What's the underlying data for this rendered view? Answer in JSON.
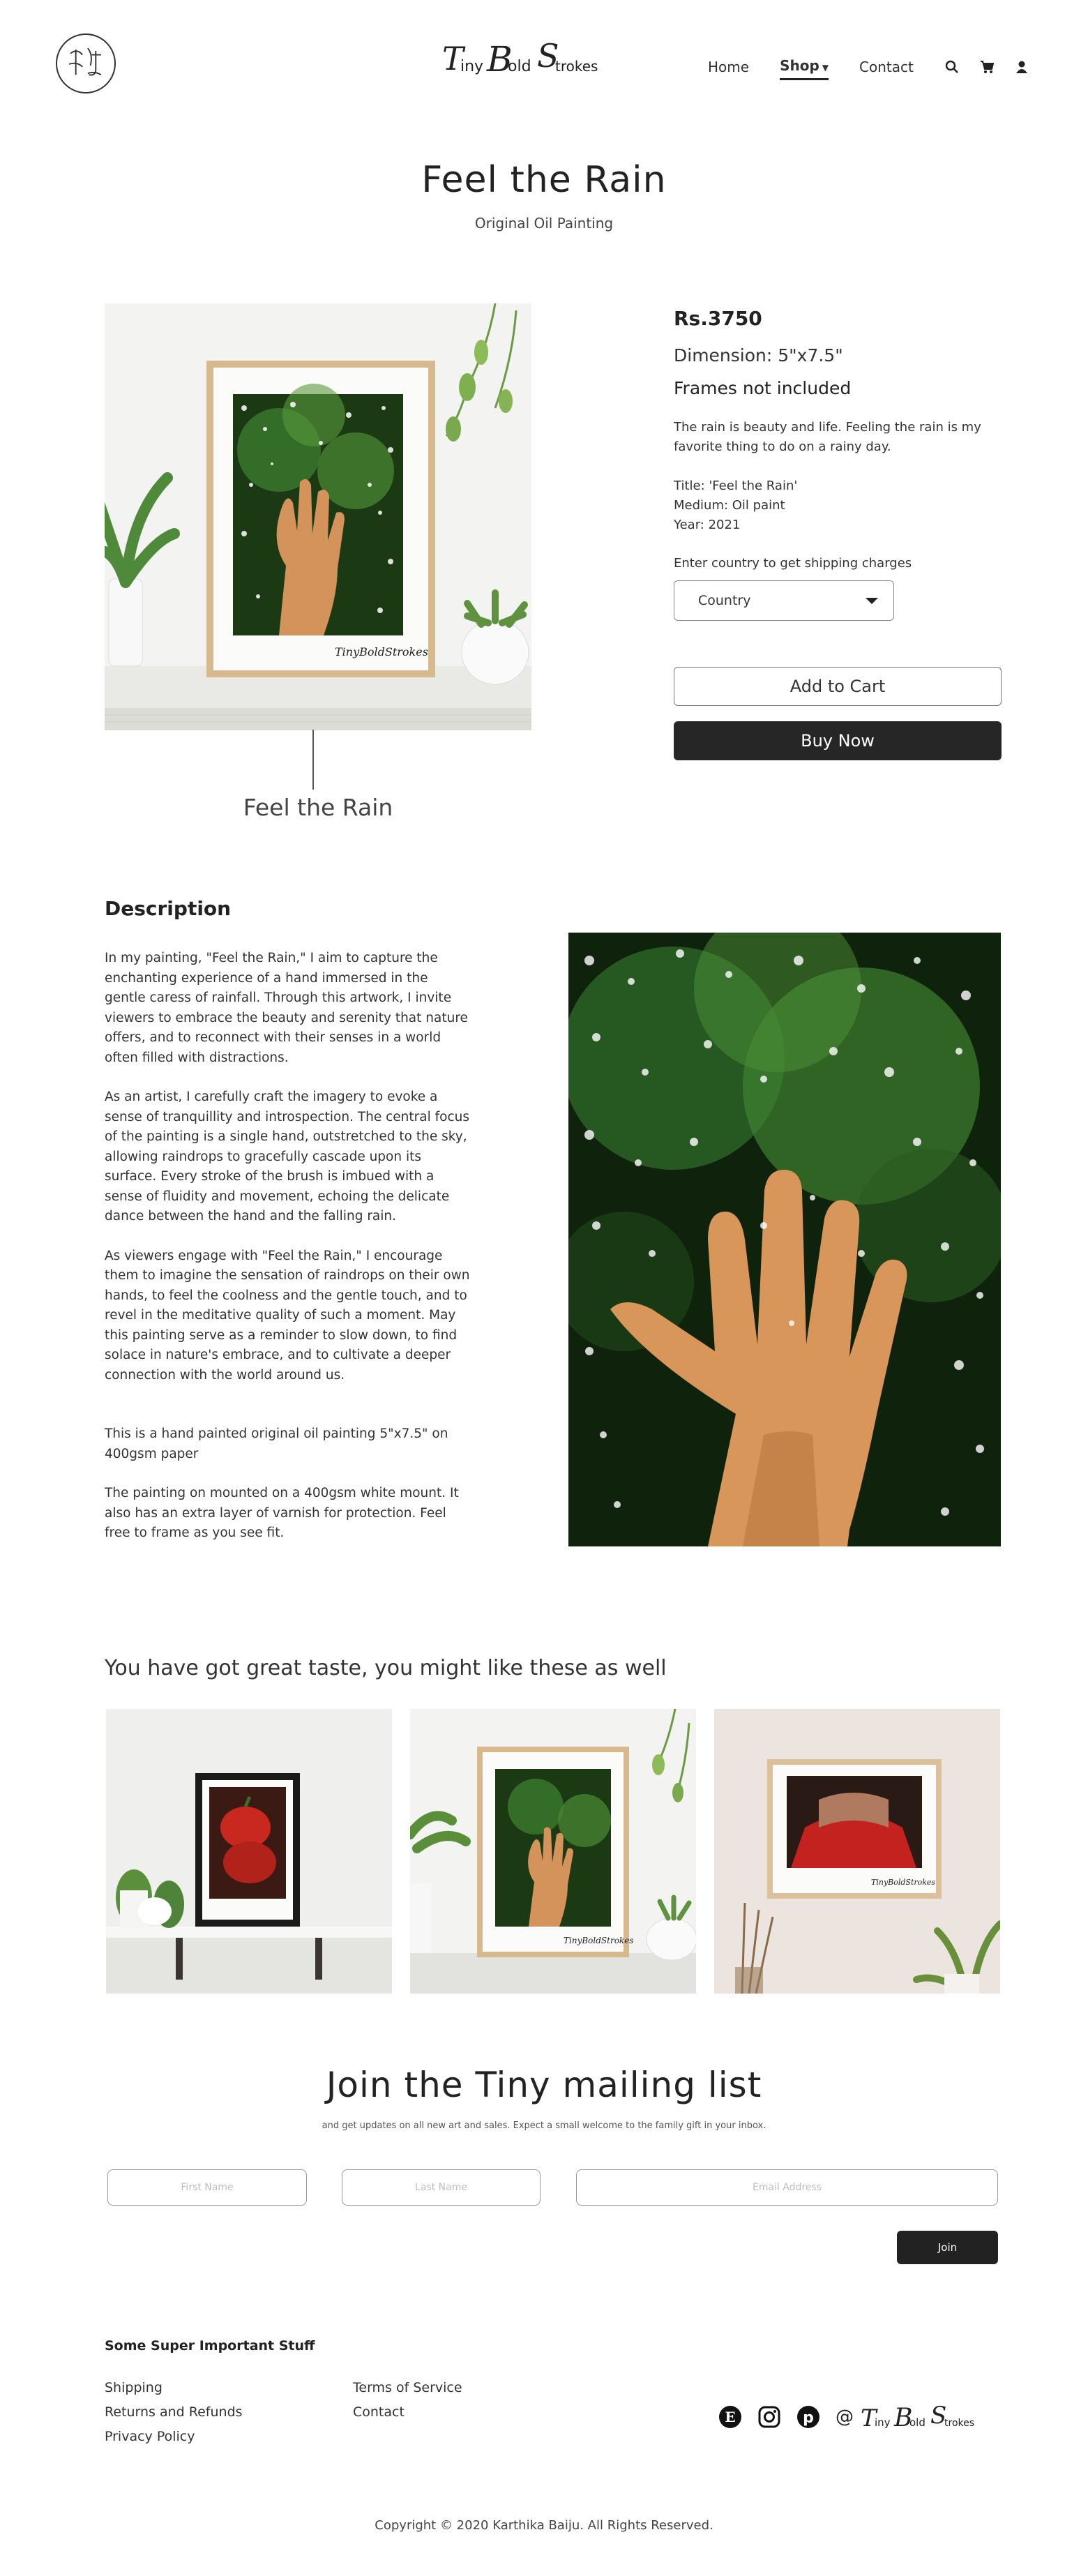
{
  "header": {
    "brand_name": "TinyBoldStrokes",
    "nav": {
      "home": "Home",
      "shop": "Shop",
      "contact": "Contact"
    },
    "icons": [
      "search-icon",
      "cart-icon",
      "account-icon"
    ]
  },
  "product": {
    "title": "Feel the Rain",
    "subtitle": "Original Oil Painting",
    "photo_caption": "Feel the Rain",
    "price": "Rs.3750",
    "dimension": "Dimension: 5\"x7.5\"",
    "frames": "Frames not included",
    "blurb": "The rain is beauty and life. Feeling the rain is my favorite thing to do on a rainy day.",
    "meta_title": "Title: 'Feel the Rain'",
    "meta_medium": "Medium: Oil paint",
    "meta_year": "Year: 2021",
    "shipping_label": "Enter country to get shipping charges",
    "country_selected": "Country",
    "add_to_cart": "Add to Cart",
    "buy_now": "Buy Now"
  },
  "description": {
    "heading": "Description",
    "p1": "In my painting, \"Feel the Rain,\" I aim to capture the enchanting experience of a hand immersed in the gentle caress of rainfall. Through this artwork, I invite viewers to embrace the beauty and serenity that nature offers, and to reconnect with their senses in a world often filled with distractions.",
    "p2": "As an artist, I carefully craft the imagery to evoke a sense of tranquillity and introspection. The central focus of the painting is a single hand, outstretched to the sky, allowing raindrops to gracefully cascade upon its surface. Every stroke of the brush is imbued with a sense of fluidity and movement, echoing the delicate dance between the hand and the falling rain.",
    "p3": "As viewers engage with \"Feel the Rain,\" I encourage them to imagine the sensation of raindrops on their own hands, to feel the coolness and the gentle touch, and to revel in the meditative quality of such a moment. May this painting serve as a reminder to slow down, to find solace in nature's embrace, and to cultivate a deeper connection with the world around us.",
    "p4": "This is a hand painted original oil painting 5\"x7.5\" on 400gsm paper",
    "p5": "The painting on mounted on a 400gsm white mount. It also has an extra layer of varnish for protection. Feel free to frame as you see fit."
  },
  "recommendations": {
    "heading": "You have got great taste, you might like these as well"
  },
  "mailing": {
    "heading": "Join the Tiny mailing list",
    "subtext": "and get updates on all new art and sales. Expect a small welcome to the family gift in your inbox.",
    "first_placeholder": "First Name",
    "last_placeholder": "Last Name",
    "email_placeholder": "Email Address",
    "join": "Join"
  },
  "footer": {
    "heading": "Some Super Important Stuff",
    "links_col1": [
      "Shipping",
      "Returns and Refunds",
      "Privacy Policy"
    ],
    "links_col2": [
      "Terms of Service",
      "Contact"
    ],
    "at": "@",
    "social_icons": [
      "etsy-icon",
      "instagram-icon",
      "pinterest-icon"
    ],
    "copyright": "Copyright © 2020 Karthika Baiju. All Rights Reserved."
  },
  "colors": {
    "text": "#2b2b2b",
    "button_dark": "#262626",
    "painting_green": "#2f6b2a",
    "skin": "#d9965a"
  }
}
